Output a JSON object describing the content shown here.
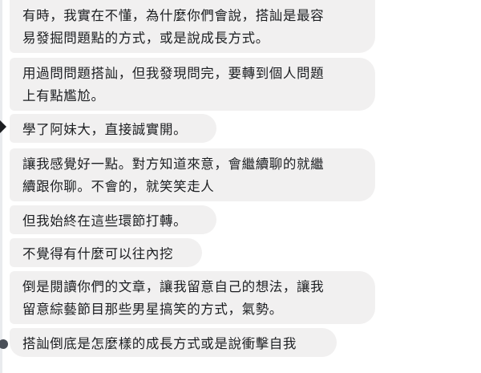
{
  "messages": [
    {
      "lines": [
        "有時，我實在不懂，為什麼你們會說，搭訕是最容",
        "易發掘問題點的方式，或是說成長方式。"
      ]
    },
    {
      "lines": [
        "用過問問題搭訕，但我發現問完，要轉到個人問題",
        "上有點尷尬。"
      ]
    },
    {
      "lines": [
        "學了阿妹大，直接誠實開。"
      ]
    },
    {
      "lines": [
        "讓我感覺好一點。對方知道來意，會繼續聊的就繼",
        "續跟你聊。不會的，就笑笑走人"
      ]
    },
    {
      "lines": [
        "但我始終在這些環節打轉。"
      ]
    },
    {
      "lines": [
        "不覺得有什麼可以往內挖"
      ]
    },
    {
      "lines": [
        "倒是閱讀你們的文章，讓我留意自己的想法，讓我",
        "留意綜藝節目那些男星搞笑的方式，氣勢。"
      ]
    },
    {
      "lines": [
        "搭訕倒底是怎麼樣的成長方式或是說衝擊自我"
      ]
    }
  ]
}
